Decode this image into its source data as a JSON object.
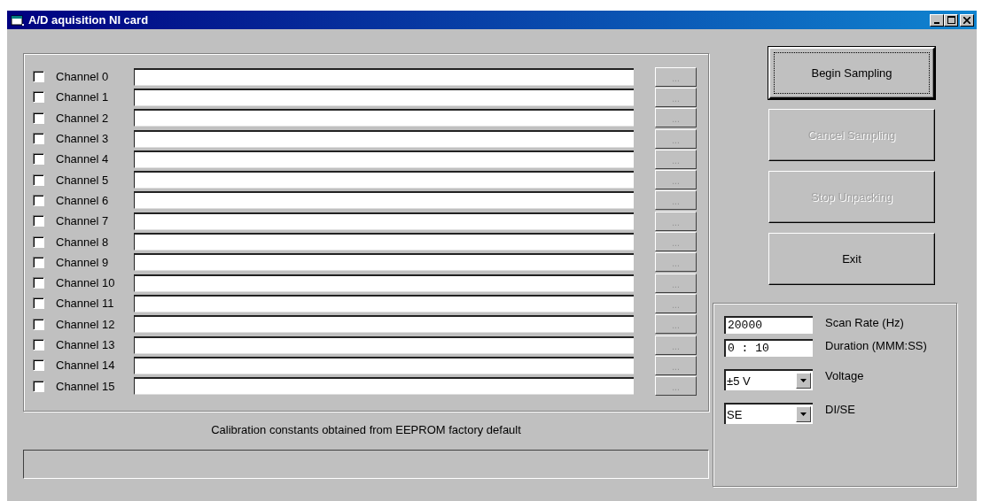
{
  "window": {
    "title": "A/D aquisition NI card"
  },
  "channels": [
    {
      "label": "Channel 0",
      "checked": false,
      "button": {
        "label": "...",
        "disabled": true
      }
    },
    {
      "label": "Channel 1",
      "checked": false,
      "button": {
        "label": "...",
        "disabled": true
      }
    },
    {
      "label": "Channel 2",
      "checked": false,
      "button": {
        "label": "...",
        "disabled": true
      }
    },
    {
      "label": "Channel 3",
      "checked": false,
      "button": {
        "label": "...",
        "disabled": true
      }
    },
    {
      "label": "Channel 4",
      "checked": false,
      "button": {
        "label": "...",
        "disabled": true
      }
    },
    {
      "label": "Channel 5",
      "checked": false,
      "button": {
        "label": "...",
        "disabled": true
      }
    },
    {
      "label": "Channel 6",
      "checked": false,
      "button": {
        "label": "...",
        "disabled": true
      }
    },
    {
      "label": "Channel 7",
      "checked": false,
      "button": {
        "label": "...",
        "disabled": true
      }
    },
    {
      "label": "Channel 8",
      "checked": false,
      "button": {
        "label": "...",
        "disabled": true
      }
    },
    {
      "label": "Channel 9",
      "checked": false,
      "button": {
        "label": "...",
        "disabled": true
      }
    },
    {
      "label": "Channel 10",
      "checked": false,
      "button": {
        "label": "...",
        "disabled": true
      }
    },
    {
      "label": "Channel 11",
      "checked": false,
      "button": {
        "label": "...",
        "disabled": true
      }
    },
    {
      "label": "Channel 12",
      "checked": false,
      "button": {
        "label": "...",
        "disabled": true
      }
    },
    {
      "label": "Channel 13",
      "checked": false,
      "button": {
        "label": "...",
        "disabled": true
      }
    },
    {
      "label": "Channel 14",
      "checked": false,
      "button": {
        "label": "...",
        "disabled": true
      }
    },
    {
      "label": "Channel 15",
      "checked": false,
      "button": {
        "label": "...",
        "disabled": true
      }
    }
  ],
  "status_text": "Calibration constants obtained from EEPROM factory default",
  "actions": [
    {
      "label": "Begin Sampling",
      "disabled": false,
      "focused": true
    },
    {
      "label": "Cancel Sampling",
      "disabled": true,
      "focused": false
    },
    {
      "label": "Stop Unpacking",
      "disabled": true,
      "focused": false
    },
    {
      "label": "Exit",
      "disabled": false,
      "focused": false
    }
  ],
  "settings": [
    {
      "kind": "text",
      "value": "20000",
      "label": "Scan Rate (Hz)"
    },
    {
      "kind": "text",
      "value": "0 : 10",
      "label": "Duration (MMM:SS)"
    },
    {
      "kind": "combo",
      "value": "±5 V",
      "label": "Voltage"
    },
    {
      "kind": "combo",
      "value": "SE",
      "label": "DI/SE"
    }
  ]
}
